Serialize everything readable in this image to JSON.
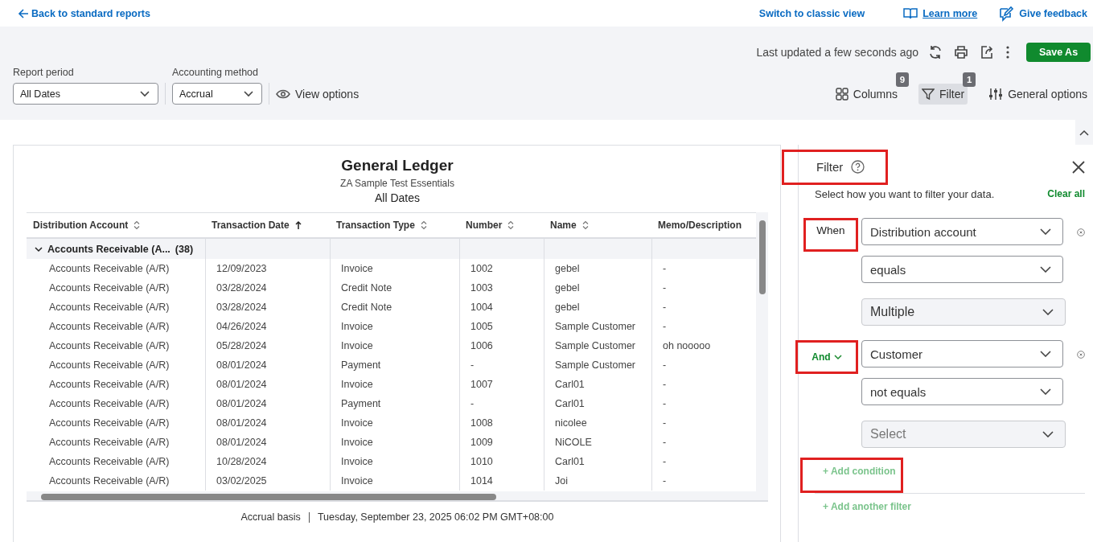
{
  "top_links": {
    "back": "Back to standard reports",
    "switch": "Switch to classic view",
    "learn": "Learn more",
    "feedback": "Give feedback"
  },
  "toolbar": {
    "last_updated": "Last updated a few seconds ago",
    "save_as": "Save As"
  },
  "report_period": {
    "label": "Report period",
    "value": "All Dates"
  },
  "accounting_method": {
    "label": "Accounting method",
    "value": "Accrual"
  },
  "view_options": "View options",
  "tools": [
    {
      "kind": "columns",
      "label": "Columns",
      "badge": "9",
      "selected": false
    },
    {
      "kind": "filter",
      "label": "Filter",
      "badge": "1",
      "selected": true
    },
    {
      "kind": "options",
      "label": "General options",
      "selected": false
    }
  ],
  "report": {
    "title": "General Ledger",
    "company": "ZA Sample Test Essentials",
    "period": "All Dates",
    "columns": [
      {
        "label": "Distribution Account",
        "sorted": false
      },
      {
        "label": "Transaction Date",
        "sorted": true
      },
      {
        "label": "Transaction Type",
        "sorted": false
      },
      {
        "label": "Number",
        "sorted": false
      },
      {
        "label": "Name",
        "sorted": false
      },
      {
        "label": "Memo/Description"
      }
    ],
    "group": {
      "label": "Accounts Receivable (A...",
      "count": "(38)",
      "expanded": true
    },
    "rows": [
      [
        "Accounts Receivable (A/R)",
        "12/09/2023",
        "Invoice",
        "1002",
        "gebel",
        "-"
      ],
      [
        "Accounts Receivable (A/R)",
        "03/28/2024",
        "Credit Note",
        "1003",
        "gebel",
        "-"
      ],
      [
        "Accounts Receivable (A/R)",
        "03/28/2024",
        "Credit Note",
        "1004",
        "gebel",
        "-"
      ],
      [
        "Accounts Receivable (A/R)",
        "04/26/2024",
        "Invoice",
        "1005",
        "Sample Customer",
        "-"
      ],
      [
        "Accounts Receivable (A/R)",
        "05/28/2024",
        "Invoice",
        "1006",
        "Sample Customer",
        "oh nooooo"
      ],
      [
        "Accounts Receivable (A/R)",
        "08/01/2024",
        "Payment",
        "-",
        "Sample Customer",
        "-"
      ],
      [
        "Accounts Receivable (A/R)",
        "08/01/2024",
        "Invoice",
        "1007",
        "Carl01",
        "-"
      ],
      [
        "Accounts Receivable (A/R)",
        "08/01/2024",
        "Payment",
        "-",
        "Carl01",
        "-"
      ],
      [
        "Accounts Receivable (A/R)",
        "08/01/2024",
        "Invoice",
        "1008",
        "nicolee",
        "-"
      ],
      [
        "Accounts Receivable (A/R)",
        "08/01/2024",
        "Invoice",
        "1009",
        "NiCOLE",
        "-"
      ],
      [
        "Accounts Receivable (A/R)",
        "10/28/2024",
        "Invoice",
        "1010",
        "Carl01",
        "-"
      ],
      [
        "Accounts Receivable (A/R)",
        "03/02/2025",
        "Invoice",
        "1014",
        "Joi",
        "-"
      ]
    ],
    "footer": {
      "basis": "Accrual basis",
      "timestamp": "Tuesday, September 23, 2025 06:02 PM GMT+08:00"
    }
  },
  "filter_panel": {
    "title": {
      "text": "Filter",
      "highlighted": true
    },
    "subtitle": "Select how you want to filter your data.",
    "clear_all": "Clear all",
    "conditions": [
      {
        "connector": "When",
        "dropdown": false,
        "highlighted": true,
        "field": "Distribution account",
        "operator": "equals",
        "value": "Multiple"
      },
      {
        "connector": "And",
        "dropdown": true,
        "highlighted": true,
        "field": "Customer",
        "operator": "not equals",
        "placeholder": "Select"
      }
    ],
    "add_condition": {
      "text": "+ Add condition",
      "highlighted": true
    },
    "add_filter": "+ Add another filter"
  }
}
